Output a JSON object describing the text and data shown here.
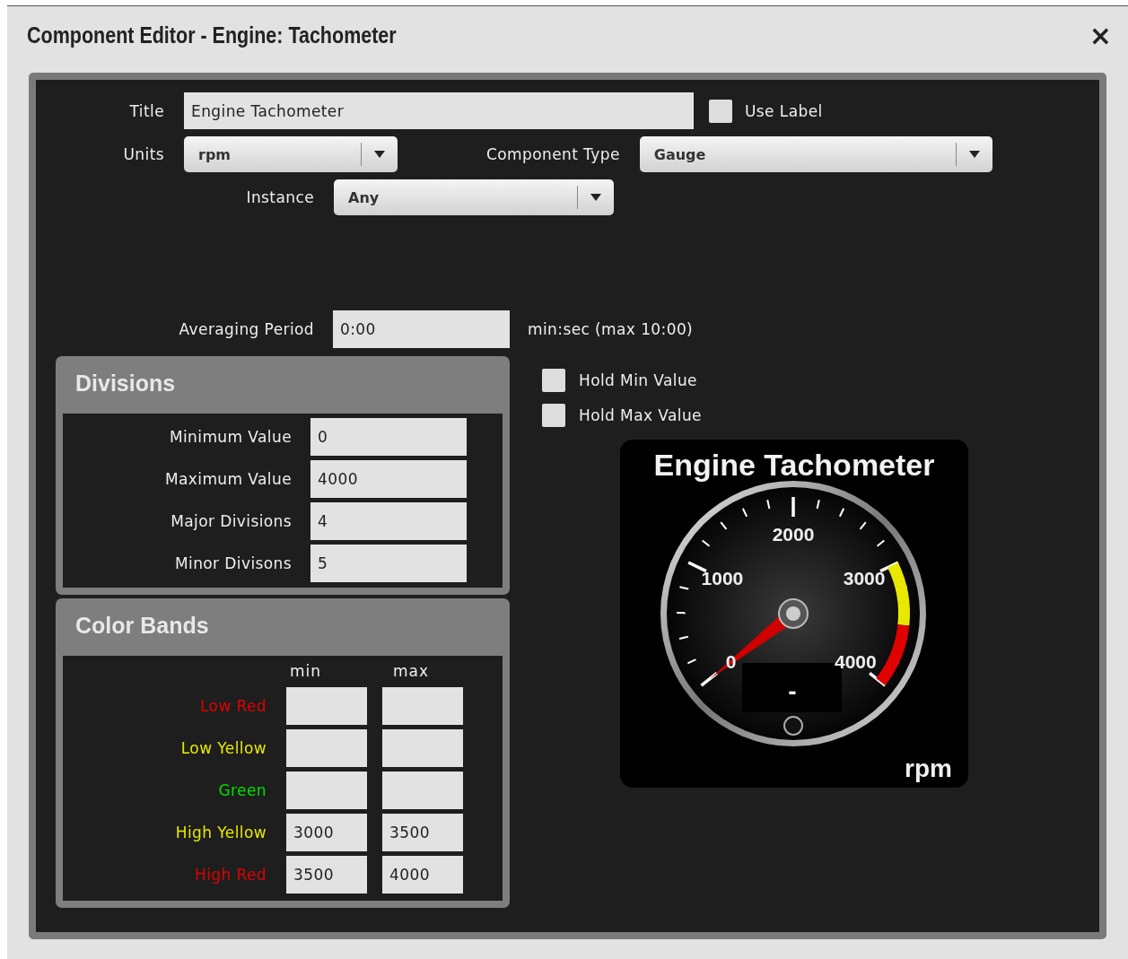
{
  "window": {
    "title": "Component Editor - Engine: Tachometer",
    "close": "×"
  },
  "form": {
    "title": {
      "label": "Title",
      "value": "Engine Tachometer"
    },
    "use_label": {
      "label": "Use Label",
      "checked": false
    },
    "units": {
      "label": "Units",
      "value": "rpm"
    },
    "component_type": {
      "label": "Component Type",
      "value": "Gauge"
    },
    "instance": {
      "label": "Instance",
      "value": "Any"
    },
    "averaging_period": {
      "label": "Averaging Period",
      "value": "0:00",
      "suffix": "min:sec (max 10:00)"
    }
  },
  "divisions": {
    "title": "Divisions",
    "fields": [
      {
        "label": "Minimum Value",
        "value": "0"
      },
      {
        "label": "Maximum Value",
        "value": "4000"
      },
      {
        "label": "Major Divisions",
        "value": "4"
      },
      {
        "label": "Minor Divisons",
        "value": "5"
      }
    ]
  },
  "color_bands": {
    "title": "Color Bands",
    "columns": [
      "min",
      "max"
    ],
    "rows": [
      {
        "label": "Low Red",
        "color": "#e00000",
        "min": "",
        "max": ""
      },
      {
        "label": "Low Yellow",
        "color": "#e8e800",
        "min": "",
        "max": ""
      },
      {
        "label": "Green",
        "color": "#00e000",
        "min": "",
        "max": ""
      },
      {
        "label": "High Yellow",
        "color": "#e8e800",
        "min": "3000",
        "max": "3500"
      },
      {
        "label": "High Red",
        "color": "#e00000",
        "min": "3500",
        "max": "4000"
      }
    ]
  },
  "hold_options": [
    {
      "label": "Hold Min Value",
      "checked": false
    },
    {
      "label": "Hold Max Value",
      "checked": false
    }
  ],
  "gauge": {
    "title": "Engine Tachometer",
    "units": "rpm",
    "scale_labels": [
      "0",
      "1000",
      "2000",
      "3000",
      "4000"
    ],
    "readout": "-"
  }
}
